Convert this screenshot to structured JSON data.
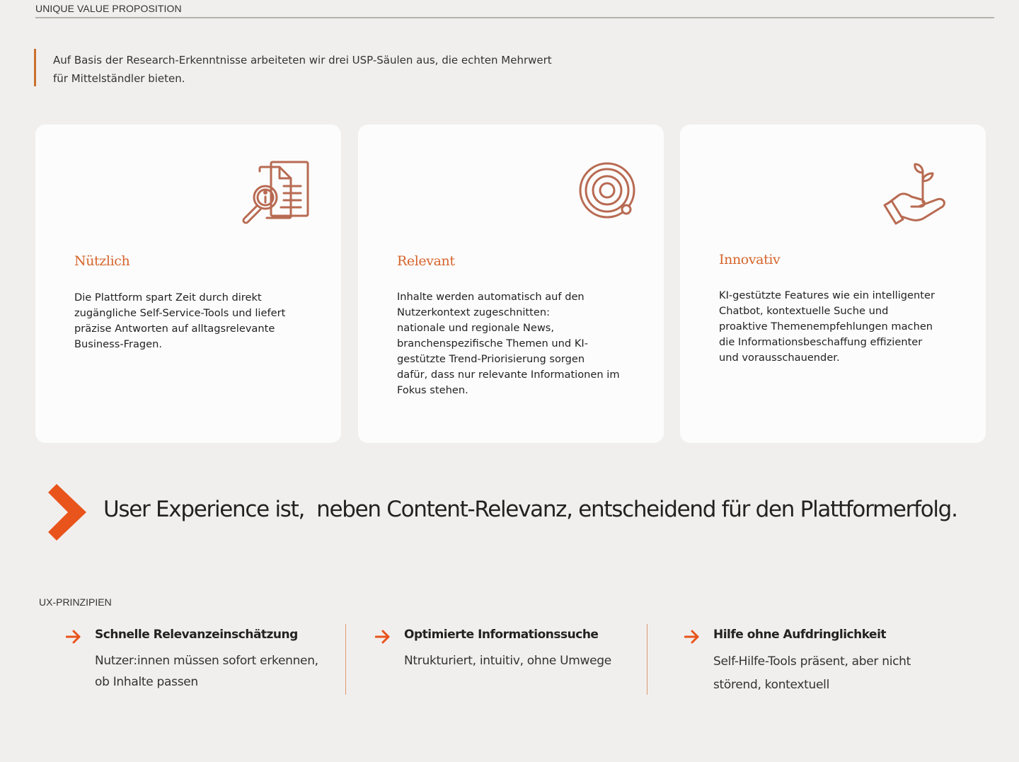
{
  "header": {
    "section_label": "UNIQUE VALUE PROPOSITION"
  },
  "intro": {
    "lines": [
      "Auf Basis der Research-Erkenntnisse arbeiteten wir drei USP-Säulen aus, die echten Mehrwert",
      "für Mittelständler bieten."
    ]
  },
  "cards": [
    {
      "icon": "document-search-icon",
      "title": "Nützlich",
      "lines": [
        "Die Plattform spart Zeit durch direkt",
        "zugängliche Self-Service-Tools und liefert",
        "präzise Antworten auf alltagsrelevante",
        "Business-Fragen."
      ]
    },
    {
      "icon": "target-icon",
      "title": "Relevant",
      "lines": [
        "Inhalte werden automatisch auf den",
        "Nutzerkontext zugeschnitten:",
        "nationale und regionale News,",
        "branchenspezifische Themen und KI-",
        "gestützte Trend-Priorisierung sorgen",
        "dafür, dass nur relevante Informationen im",
        "Fokus stehen."
      ]
    },
    {
      "icon": "hand-plant-icon",
      "title": "Innovativ",
      "lines": [
        "KI-gestützte Features wie ein intelligenter",
        "Chatbot, kontextuelle Suche und",
        "proaktive Themenempfehlungen machen",
        "die Informationsbeschaffung effizienter",
        "und vorausschauender."
      ]
    }
  ],
  "headline": {
    "text": "User Experience ist,  neben Content-Relevanz, entscheidend für den Plattformerfolg."
  },
  "ux": {
    "label": "UX-PRINZIPIEN",
    "principles": [
      {
        "title": "Schnelle Relevanzeinschätzung",
        "lines": [
          "Nutzer:innen müssen sofort erkennen,",
          "ob Inhalte passen"
        ]
      },
      {
        "title": "Optimierte Informationssuche",
        "lines": [
          "Ntrukturiert, intuitiv, ohne Umwege"
        ]
      },
      {
        "title": "Hilfe ohne Aufdringlichkeit",
        "lines": [
          "Self-Hilfe-Tools präsent, aber nicht",
          "störend, kontextuell"
        ]
      }
    ]
  },
  "colors": {
    "accent": "#d7642b",
    "icon": "#b86a52",
    "chevron": "#e8541c",
    "intro_bar": "#c9702f",
    "background": "#f1efed",
    "card": "#fcfcfc"
  }
}
